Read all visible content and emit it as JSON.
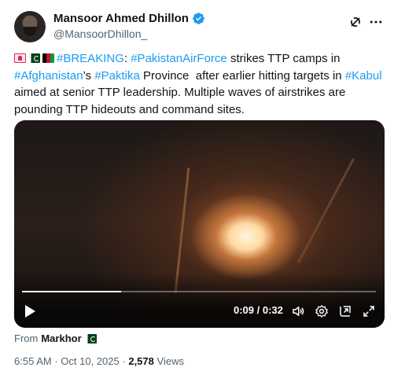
{
  "author": {
    "name": "Mansoor Ahmed Dhillon",
    "handle": "@MansoorDhillon_"
  },
  "tweet": {
    "segments": [
      {
        "text": "#BREAKING",
        "tag": true
      },
      {
        "text": ": ",
        "tag": false
      },
      {
        "text": "#PakistanAirForce",
        "tag": true
      },
      {
        "text": " strikes TTP camps in ",
        "tag": false
      },
      {
        "text": "#Afghanistan",
        "tag": true
      },
      {
        "text": "’s ",
        "tag": false
      },
      {
        "text": "#Paktika",
        "tag": true
      },
      {
        "text": " Province  after earlier hitting targets in ",
        "tag": false
      },
      {
        "text": "#Kabul",
        "tag": true
      },
      {
        "text": " aimed at senior TTP leadership. Multiple waves of airstrikes are pounding TTP hideouts and command sites.",
        "tag": false
      }
    ],
    "leading_icons": [
      "alert-siren-icon",
      "pakistan-flag-icon",
      "afghanistan-flag-icon"
    ]
  },
  "video": {
    "time_display": "0:09 / 0:32",
    "progress": 0.28
  },
  "source": {
    "prefix": "From",
    "name": "Markhor",
    "icon": "pakistan-flag-icon"
  },
  "meta": {
    "time": "6:55 AM",
    "date": "Oct 10, 2025",
    "separator": "·",
    "views_count": "2,578",
    "views_label": "Views"
  },
  "colors": {
    "accent": "#1d9bf0",
    "text": "#0f1419",
    "muted": "#536471"
  }
}
